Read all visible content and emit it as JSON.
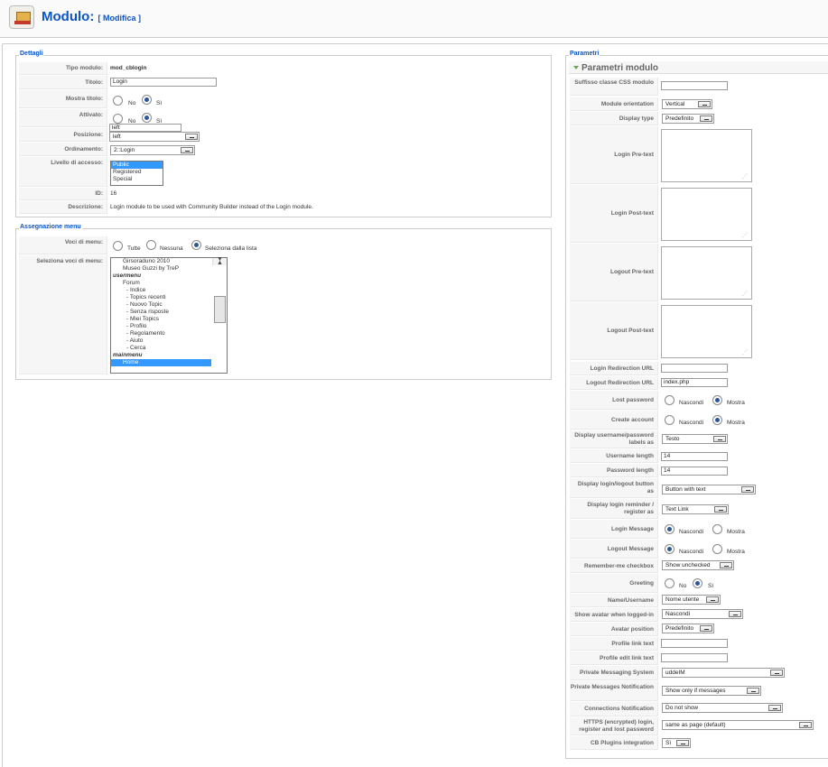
{
  "header": {
    "title": "Modulo:",
    "subtitle": "[ Modifica ]"
  },
  "dettagli": {
    "legend": "Dettagli",
    "tipo_modulo_label": "Tipo modulo:",
    "tipo_modulo_value": "mod_cblogin",
    "titolo_label": "Titolo:",
    "titolo_value": "Login",
    "mostra_titolo_label": "Mostra titolo:",
    "no": "No",
    "si": "Sì",
    "attivato_label": "Attivato:",
    "posizione_label": "Posizione:",
    "posizione_value": "left",
    "posizione_dropdown": "left",
    "ordinamento_label": "Ordinamento:",
    "ordinamento_value": "2::Login",
    "livello_label": "Livello di accesso:",
    "livello_options": [
      "Public",
      "Registered",
      "Special"
    ],
    "id_label": "ID:",
    "id_value": "16",
    "descrizione_label": "Descrizione:",
    "descrizione_value": "Login module to be used with Community Builder instead of the Login module."
  },
  "assegnazione": {
    "legend": "Assegnazione menu",
    "voci_label": "Voci di menu:",
    "tutte": "Tutte",
    "nessuna": "Nessuna",
    "seleziona": "Seleziona dalla lista",
    "seleziona_voci_label": "Seleziona voci di menu:",
    "items": [
      "Girsoraduno 2010",
      "Museo Guzzi by TreP",
      "usermenu",
      "Forum",
      "- Indice",
      "- Topics recenti",
      "- Nuovo Topic",
      "- Senza risposte",
      "- Miei Topics",
      "- Profilo",
      "- Regolamento",
      "- Aiuto",
      "- Cerca",
      "mainmenu",
      "Home"
    ]
  },
  "parametri": {
    "legend": "Parametri",
    "section_title": "Parametri modulo",
    "suffisso_label": "Suffisso classe CSS modulo",
    "orientation_label": "Module orientation",
    "orientation_value": "Vertical",
    "display_type_label": "Display type",
    "display_type_value": "Predefinito",
    "login_pre_label": "Login Pre-text",
    "login_post_label": "Login Post-text",
    "logout_pre_label": "Logout Pre-text",
    "logout_post_label": "Logout Post-text",
    "login_redirect_label": "Login Redirection URL",
    "logout_redirect_label": "Logout Redirection URL",
    "logout_redirect_value": "index.php",
    "lost_password_label": "Lost password",
    "nascondi": "Nascondi",
    "mostra": "Mostra",
    "create_account_label": "Create account",
    "display_labels_label": "Display username/password labels as",
    "display_labels_value": "Testo",
    "username_length_label": "Username length",
    "username_length_value": "14",
    "password_length_label": "Password length",
    "password_length_value": "14",
    "display_button_label": "Display login/logout button as",
    "display_button_value": "Button with text",
    "display_reminder_label": "Display login reminder / register as",
    "display_reminder_value": "Text Link",
    "login_message_label": "Login Message",
    "logout_message_label": "Logout Message",
    "remember_label": "Remember-me checkbox",
    "remember_value": "Show unchecked",
    "greeting_label": "Greeting",
    "no": "No",
    "si": "Sì",
    "name_label": "Name/Username",
    "name_value": "Nome utente",
    "show_avatar_label": "Show avatar when logged-in",
    "show_avatar_value": "Nascondi",
    "avatar_pos_label": "Avatar position",
    "avatar_pos_value": "Predefinito",
    "profile_link_label": "Profile link text",
    "profile_edit_label": "Profile edit link text",
    "pms_label": "Private Messaging System",
    "pms_value": "uddeIM",
    "pm_notif_label": "Private Messages Notification",
    "pm_notif_value": "Show only if messages",
    "conn_notif_label": "Connections Notification",
    "conn_notif_value": "Do not show",
    "https_label": "HTTPS (encrypted) login, register and lost password",
    "https_value": "same as page (default)",
    "cb_plugins_label": "CB Plugins integration",
    "cb_plugins_value": "Sì"
  }
}
